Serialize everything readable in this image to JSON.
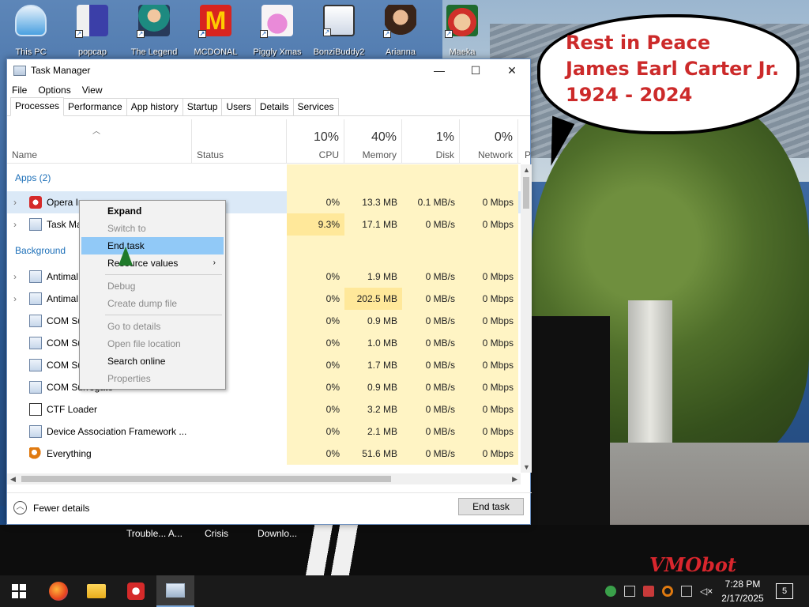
{
  "desktop": {
    "icons": [
      {
        "label": "This PC"
      },
      {
        "label": "popcap"
      },
      {
        "label": "The Legend"
      },
      {
        "label": "MCDONAL"
      },
      {
        "label": "Piggly Xmas"
      },
      {
        "label": "BonziBuddy2"
      },
      {
        "label": "Arianna"
      },
      {
        "label": "Maeka"
      }
    ],
    "bubble": {
      "line1": "Rest in Peace",
      "line2": "James Earl Carter Jr.",
      "line3": "1924 - 2024"
    },
    "watermark": "VMObot",
    "background_windows": [
      "Trouble... A...",
      "Crisis",
      "Downlo..."
    ]
  },
  "window": {
    "title": "Task Manager",
    "menu": [
      "File",
      "Options",
      "View"
    ],
    "tabs": [
      "Processes",
      "Performance",
      "App history",
      "Startup",
      "Users",
      "Details",
      "Services"
    ],
    "active_tab": "Processes",
    "columns": {
      "name": "Name",
      "status": "Status",
      "cpu": {
        "pct": "10%",
        "label": "CPU"
      },
      "memory": {
        "pct": "40%",
        "label": "Memory"
      },
      "disk": {
        "pct": "1%",
        "label": "Disk"
      },
      "network": {
        "pct": "0%",
        "label": "Network"
      },
      "power": "P"
    },
    "groups": {
      "apps": "Apps (2)",
      "background": "Background"
    },
    "rows": [
      {
        "name": "Opera In",
        "cpu": "0%",
        "mem": "13.3 MB",
        "disk": "0.1 MB/s",
        "net": "0 Mbps"
      },
      {
        "name": "Task Ma",
        "cpu": "9.3%",
        "mem": "17.1 MB",
        "disk": "0 MB/s",
        "net": "0 Mbps"
      },
      {
        "name": "Antimal",
        "cpu": "0%",
        "mem": "1.9 MB",
        "disk": "0 MB/s",
        "net": "0 Mbps"
      },
      {
        "name": "Antimal",
        "cpu": "0%",
        "mem": "202.5 MB",
        "disk": "0 MB/s",
        "net": "0 Mbps"
      },
      {
        "name": "COM Su",
        "cpu": "0%",
        "mem": "0.9 MB",
        "disk": "0 MB/s",
        "net": "0 Mbps"
      },
      {
        "name": "COM Su",
        "cpu": "0%",
        "mem": "1.0 MB",
        "disk": "0 MB/s",
        "net": "0 Mbps"
      },
      {
        "name": "COM Su",
        "cpu": "0%",
        "mem": "1.7 MB",
        "disk": "0 MB/s",
        "net": "0 Mbps"
      },
      {
        "name": "COM Surrogate",
        "cpu": "0%",
        "mem": "0.9 MB",
        "disk": "0 MB/s",
        "net": "0 Mbps"
      },
      {
        "name": "CTF Loader",
        "cpu": "0%",
        "mem": "3.2 MB",
        "disk": "0 MB/s",
        "net": "0 Mbps"
      },
      {
        "name": "Device Association Framework ...",
        "cpu": "0%",
        "mem": "2.1 MB",
        "disk": "0 MB/s",
        "net": "0 Mbps"
      },
      {
        "name": "Everything",
        "cpu": "0%",
        "mem": "51.6 MB",
        "disk": "0 MB/s",
        "net": "0 Mbps"
      }
    ],
    "footer": {
      "fewer_details": "Fewer details",
      "end_task": "End task"
    }
  },
  "context_menu": {
    "items": [
      {
        "label": "Expand",
        "state": "bold"
      },
      {
        "label": "Switch to",
        "state": "disabled"
      },
      {
        "label": "End task",
        "state": "hover"
      },
      {
        "label": "Resource values",
        "state": "submenu"
      },
      {
        "label": "Debug",
        "state": "disabled"
      },
      {
        "label": "Create dump file",
        "state": "disabled"
      },
      {
        "label": "Go to details",
        "state": "disabled"
      },
      {
        "label": "Open file location",
        "state": "disabled"
      },
      {
        "label": "Search online",
        "state": "normal"
      },
      {
        "label": "Properties",
        "state": "disabled"
      }
    ]
  },
  "taskbar": {
    "time": "7:28 PM",
    "date": "2/17/2025",
    "notifications": "5"
  }
}
